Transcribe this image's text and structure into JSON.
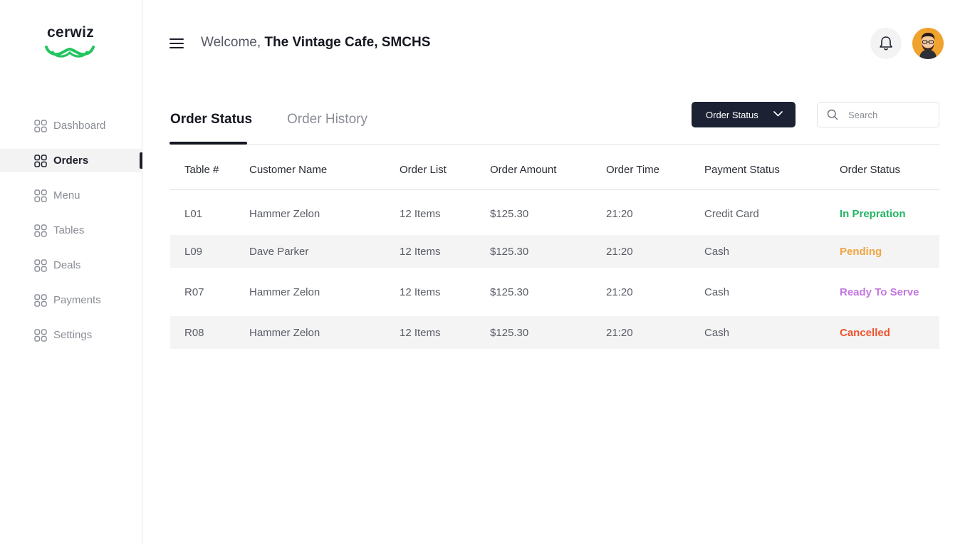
{
  "brand": {
    "name": "cerwiz",
    "accent": "#22c55e"
  },
  "header": {
    "welcome_prefix": "Welcome,",
    "restaurant": "The Vintage Cafe, SMCHS"
  },
  "sidebar": {
    "items": [
      {
        "label": "Dashboard",
        "active": false
      },
      {
        "label": "Orders",
        "active": true
      },
      {
        "label": "Menu",
        "active": false
      },
      {
        "label": "Tables",
        "active": false
      },
      {
        "label": "Deals",
        "active": false
      },
      {
        "label": "Payments",
        "active": false
      },
      {
        "label": "Settings",
        "active": false
      }
    ]
  },
  "tabs": [
    {
      "label": "Order Status",
      "active": true
    },
    {
      "label": "Order History",
      "active": false
    }
  ],
  "filter": {
    "label": "Order Status"
  },
  "search": {
    "placeholder": "Search"
  },
  "table": {
    "headers": [
      "Table #",
      "Customer Name",
      "Order List",
      "Order Amount",
      "Order Time",
      "Payment Status",
      "Order Status"
    ],
    "rows": [
      {
        "table": "L01",
        "customer": "Hammer Zelon",
        "items": "12 Items",
        "amount": "$125.30",
        "time": "21:20",
        "payment": "Credit Card",
        "status": "In Prepration",
        "status_color": "#22b563"
      },
      {
        "table": "L09",
        "customer": "Dave Parker",
        "items": "12 Items",
        "amount": "$125.30",
        "time": "21:20",
        "payment": "Cash",
        "status": "Pending",
        "status_color": "#f2a541"
      },
      {
        "table": "R07",
        "customer": "Hammer Zelon",
        "items": "12 Items",
        "amount": "$125.30",
        "time": "21:20",
        "payment": "Cash",
        "status": "Ready To Serve",
        "status_color": "#c377e0"
      },
      {
        "table": "R08",
        "customer": "Hammer Zelon",
        "items": "12 Items",
        "amount": "$125.30",
        "time": "21:20",
        "payment": "Cash",
        "status": "Cancelled",
        "status_color": "#f0522c"
      }
    ]
  }
}
